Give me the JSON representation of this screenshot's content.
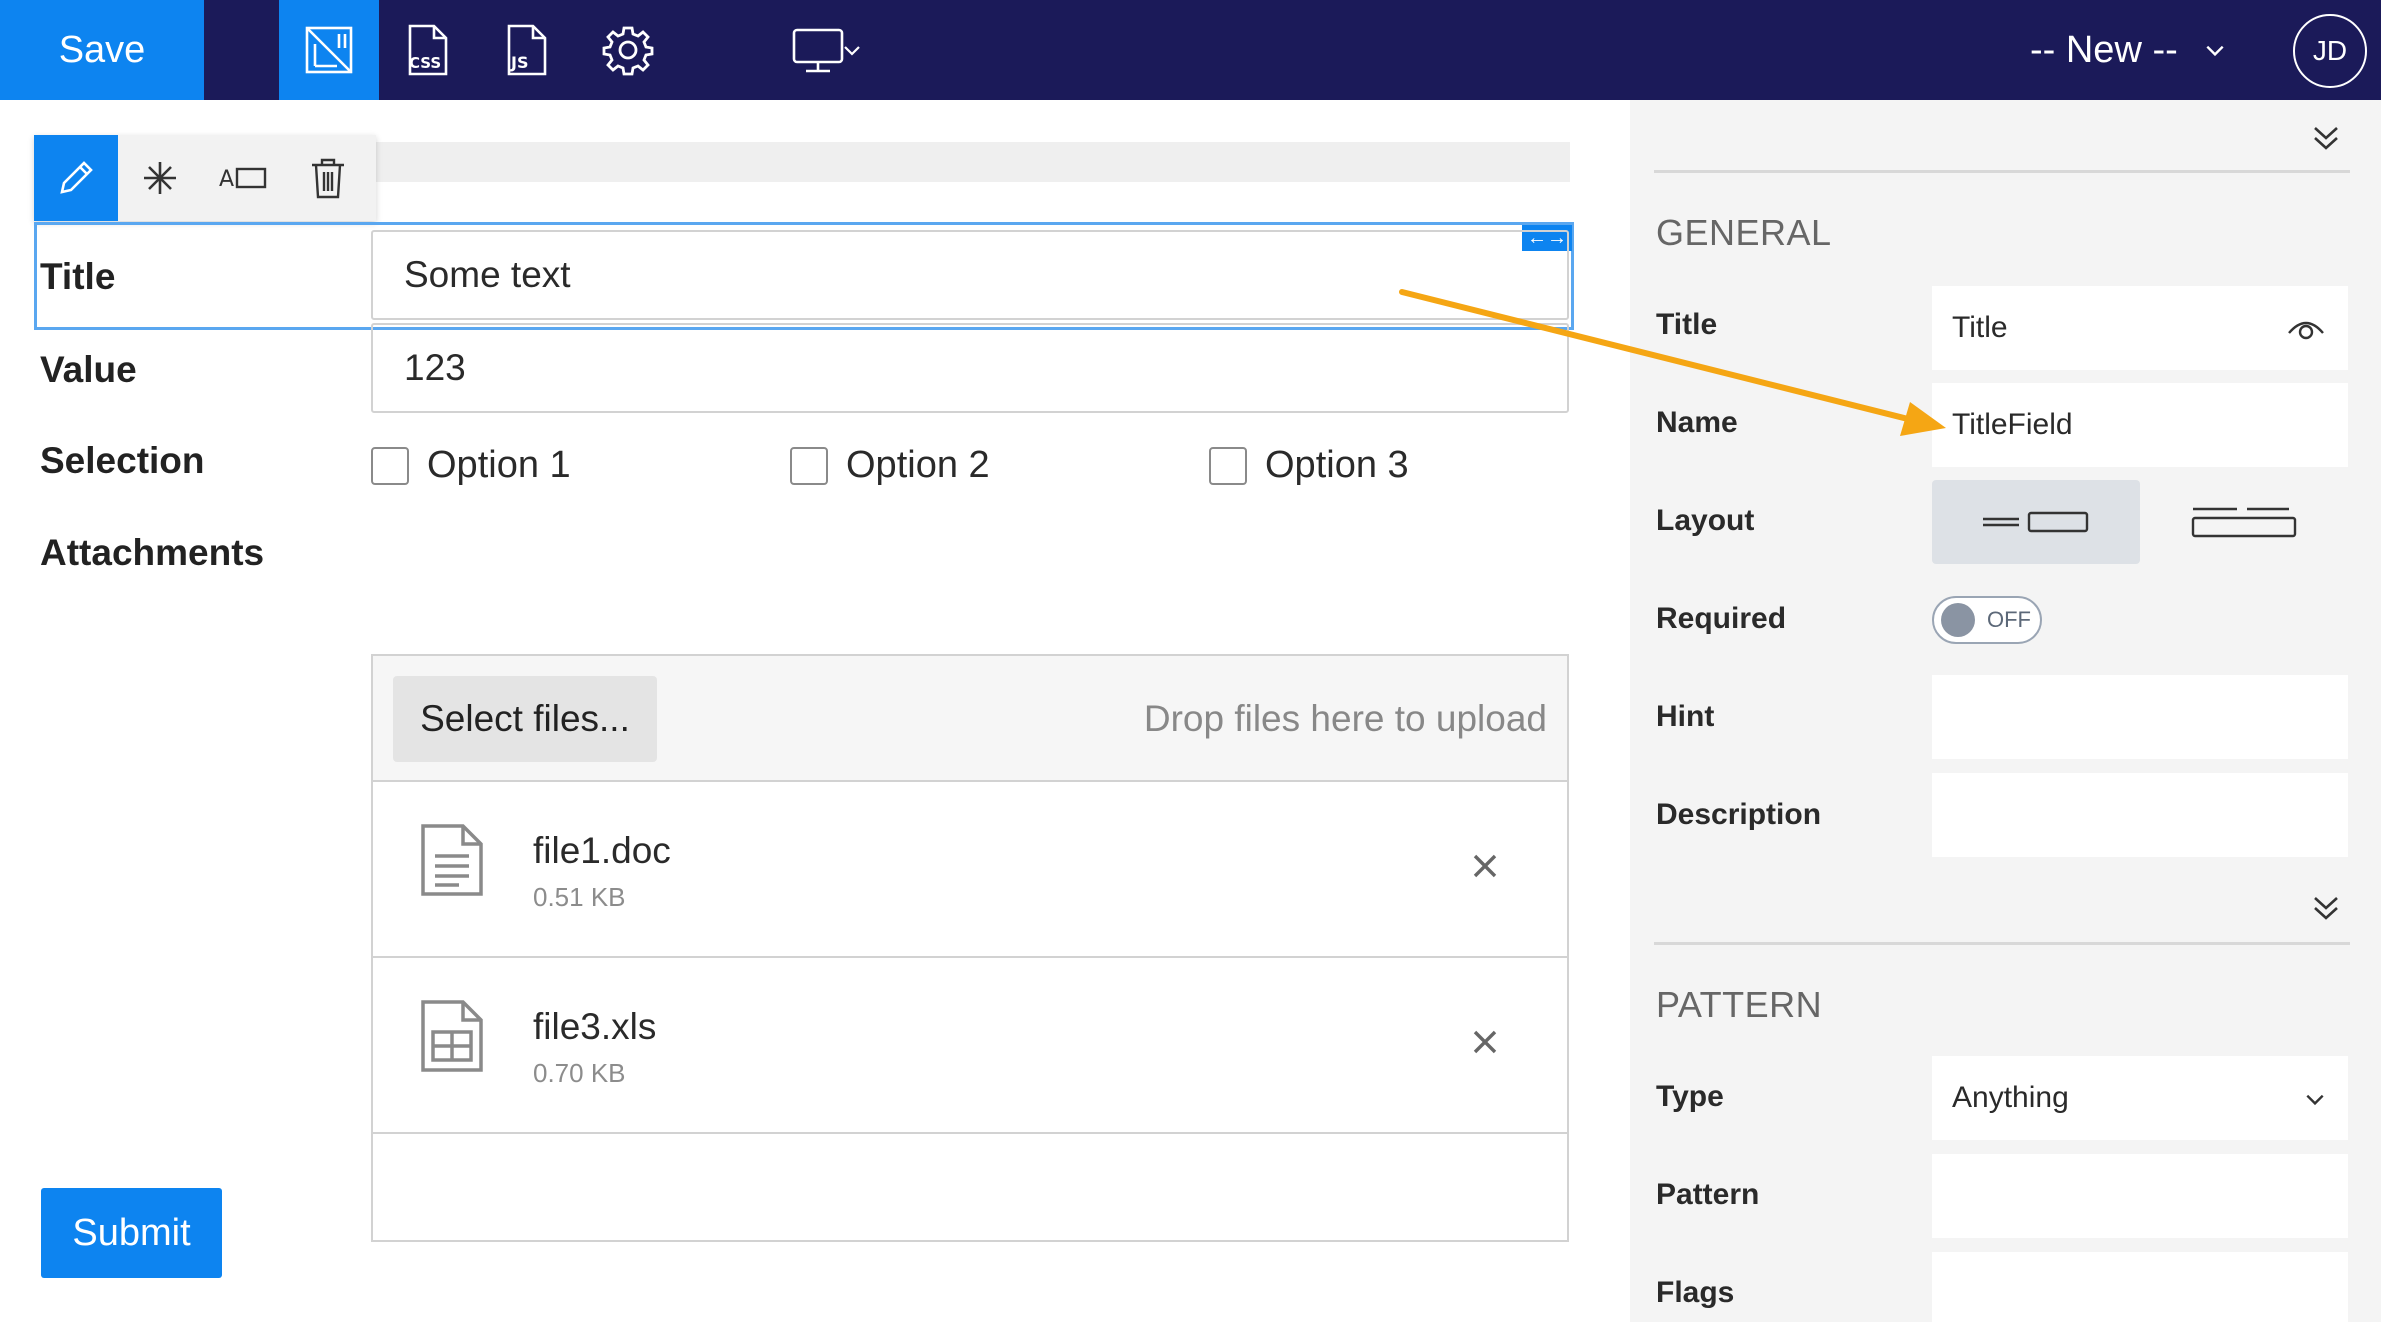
{
  "toolbar": {
    "save_label": "Save",
    "icons": [
      "form-designer-icon",
      "css-icon",
      "js-icon",
      "settings-icon",
      "monitor-icon"
    ],
    "new_dropdown_label": "-- New --",
    "avatar_initials": "JD",
    "accent_color": "#0d84f0",
    "bar_color": "#1b1a59"
  },
  "form": {
    "title_label": "Title",
    "title_value": "Some text",
    "value_label": "Value",
    "value_value": "123",
    "selection_label": "Selection",
    "options": [
      "Option 1",
      "Option 2",
      "Option 3"
    ],
    "attachments_label": "Attachments",
    "select_files_label": "Select files...",
    "drop_hint": "Drop files here to upload",
    "files": [
      {
        "name": "file1.doc",
        "size": "0.51 KB",
        "icon": "document-icon"
      },
      {
        "name": "file3.xls",
        "size": "0.70 KB",
        "icon": "spreadsheet-icon"
      }
    ],
    "submit_label": "Submit"
  },
  "panel": {
    "general_title": "GENERAL",
    "title_label": "Title",
    "title_value": "Title",
    "name_label": "Name",
    "name_value": "TitleField",
    "layout_label": "Layout",
    "required_label": "Required",
    "required_state": "OFF",
    "hint_label": "Hint",
    "hint_value": "",
    "description_label": "Description",
    "description_value": "",
    "pattern_title": "PATTERN",
    "type_label": "Type",
    "type_value": "Anything",
    "pattern_label": "Pattern",
    "pattern_value": "",
    "flags_label": "Flags",
    "flags_value": ""
  }
}
